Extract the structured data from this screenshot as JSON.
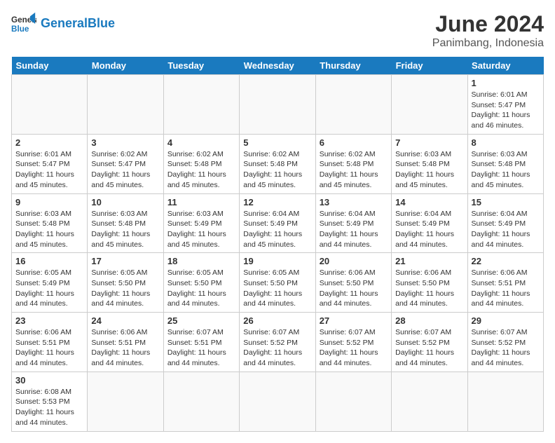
{
  "header": {
    "logo_general": "General",
    "logo_blue": "Blue",
    "title": "June 2024",
    "subtitle": "Panimbang, Indonesia"
  },
  "days_of_week": [
    "Sunday",
    "Monday",
    "Tuesday",
    "Wednesday",
    "Thursday",
    "Friday",
    "Saturday"
  ],
  "weeks": [
    [
      {
        "day": null,
        "info": null
      },
      {
        "day": null,
        "info": null
      },
      {
        "day": null,
        "info": null
      },
      {
        "day": null,
        "info": null
      },
      {
        "day": null,
        "info": null
      },
      {
        "day": null,
        "info": null
      },
      {
        "day": "1",
        "info": "Sunrise: 6:01 AM\nSunset: 5:47 PM\nDaylight: 11 hours and 46 minutes."
      }
    ],
    [
      {
        "day": "2",
        "info": "Sunrise: 6:01 AM\nSunset: 5:47 PM\nDaylight: 11 hours and 45 minutes."
      },
      {
        "day": "3",
        "info": "Sunrise: 6:02 AM\nSunset: 5:47 PM\nDaylight: 11 hours and 45 minutes."
      },
      {
        "day": "4",
        "info": "Sunrise: 6:02 AM\nSunset: 5:48 PM\nDaylight: 11 hours and 45 minutes."
      },
      {
        "day": "5",
        "info": "Sunrise: 6:02 AM\nSunset: 5:48 PM\nDaylight: 11 hours and 45 minutes."
      },
      {
        "day": "6",
        "info": "Sunrise: 6:02 AM\nSunset: 5:48 PM\nDaylight: 11 hours and 45 minutes."
      },
      {
        "day": "7",
        "info": "Sunrise: 6:03 AM\nSunset: 5:48 PM\nDaylight: 11 hours and 45 minutes."
      },
      {
        "day": "8",
        "info": "Sunrise: 6:03 AM\nSunset: 5:48 PM\nDaylight: 11 hours and 45 minutes."
      }
    ],
    [
      {
        "day": "9",
        "info": "Sunrise: 6:03 AM\nSunset: 5:48 PM\nDaylight: 11 hours and 45 minutes."
      },
      {
        "day": "10",
        "info": "Sunrise: 6:03 AM\nSunset: 5:48 PM\nDaylight: 11 hours and 45 minutes."
      },
      {
        "day": "11",
        "info": "Sunrise: 6:03 AM\nSunset: 5:49 PM\nDaylight: 11 hours and 45 minutes."
      },
      {
        "day": "12",
        "info": "Sunrise: 6:04 AM\nSunset: 5:49 PM\nDaylight: 11 hours and 45 minutes."
      },
      {
        "day": "13",
        "info": "Sunrise: 6:04 AM\nSunset: 5:49 PM\nDaylight: 11 hours and 44 minutes."
      },
      {
        "day": "14",
        "info": "Sunrise: 6:04 AM\nSunset: 5:49 PM\nDaylight: 11 hours and 44 minutes."
      },
      {
        "day": "15",
        "info": "Sunrise: 6:04 AM\nSunset: 5:49 PM\nDaylight: 11 hours and 44 minutes."
      }
    ],
    [
      {
        "day": "16",
        "info": "Sunrise: 6:05 AM\nSunset: 5:49 PM\nDaylight: 11 hours and 44 minutes."
      },
      {
        "day": "17",
        "info": "Sunrise: 6:05 AM\nSunset: 5:50 PM\nDaylight: 11 hours and 44 minutes."
      },
      {
        "day": "18",
        "info": "Sunrise: 6:05 AM\nSunset: 5:50 PM\nDaylight: 11 hours and 44 minutes."
      },
      {
        "day": "19",
        "info": "Sunrise: 6:05 AM\nSunset: 5:50 PM\nDaylight: 11 hours and 44 minutes."
      },
      {
        "day": "20",
        "info": "Sunrise: 6:06 AM\nSunset: 5:50 PM\nDaylight: 11 hours and 44 minutes."
      },
      {
        "day": "21",
        "info": "Sunrise: 6:06 AM\nSunset: 5:50 PM\nDaylight: 11 hours and 44 minutes."
      },
      {
        "day": "22",
        "info": "Sunrise: 6:06 AM\nSunset: 5:51 PM\nDaylight: 11 hours and 44 minutes."
      }
    ],
    [
      {
        "day": "23",
        "info": "Sunrise: 6:06 AM\nSunset: 5:51 PM\nDaylight: 11 hours and 44 minutes."
      },
      {
        "day": "24",
        "info": "Sunrise: 6:06 AM\nSunset: 5:51 PM\nDaylight: 11 hours and 44 minutes."
      },
      {
        "day": "25",
        "info": "Sunrise: 6:07 AM\nSunset: 5:51 PM\nDaylight: 11 hours and 44 minutes."
      },
      {
        "day": "26",
        "info": "Sunrise: 6:07 AM\nSunset: 5:52 PM\nDaylight: 11 hours and 44 minutes."
      },
      {
        "day": "27",
        "info": "Sunrise: 6:07 AM\nSunset: 5:52 PM\nDaylight: 11 hours and 44 minutes."
      },
      {
        "day": "28",
        "info": "Sunrise: 6:07 AM\nSunset: 5:52 PM\nDaylight: 11 hours and 44 minutes."
      },
      {
        "day": "29",
        "info": "Sunrise: 6:07 AM\nSunset: 5:52 PM\nDaylight: 11 hours and 44 minutes."
      }
    ],
    [
      {
        "day": "30",
        "info": "Sunrise: 6:08 AM\nSunset: 5:53 PM\nDaylight: 11 hours and 44 minutes."
      },
      {
        "day": null,
        "info": null
      },
      {
        "day": null,
        "info": null
      },
      {
        "day": null,
        "info": null
      },
      {
        "day": null,
        "info": null
      },
      {
        "day": null,
        "info": null
      },
      {
        "day": null,
        "info": null
      }
    ]
  ]
}
